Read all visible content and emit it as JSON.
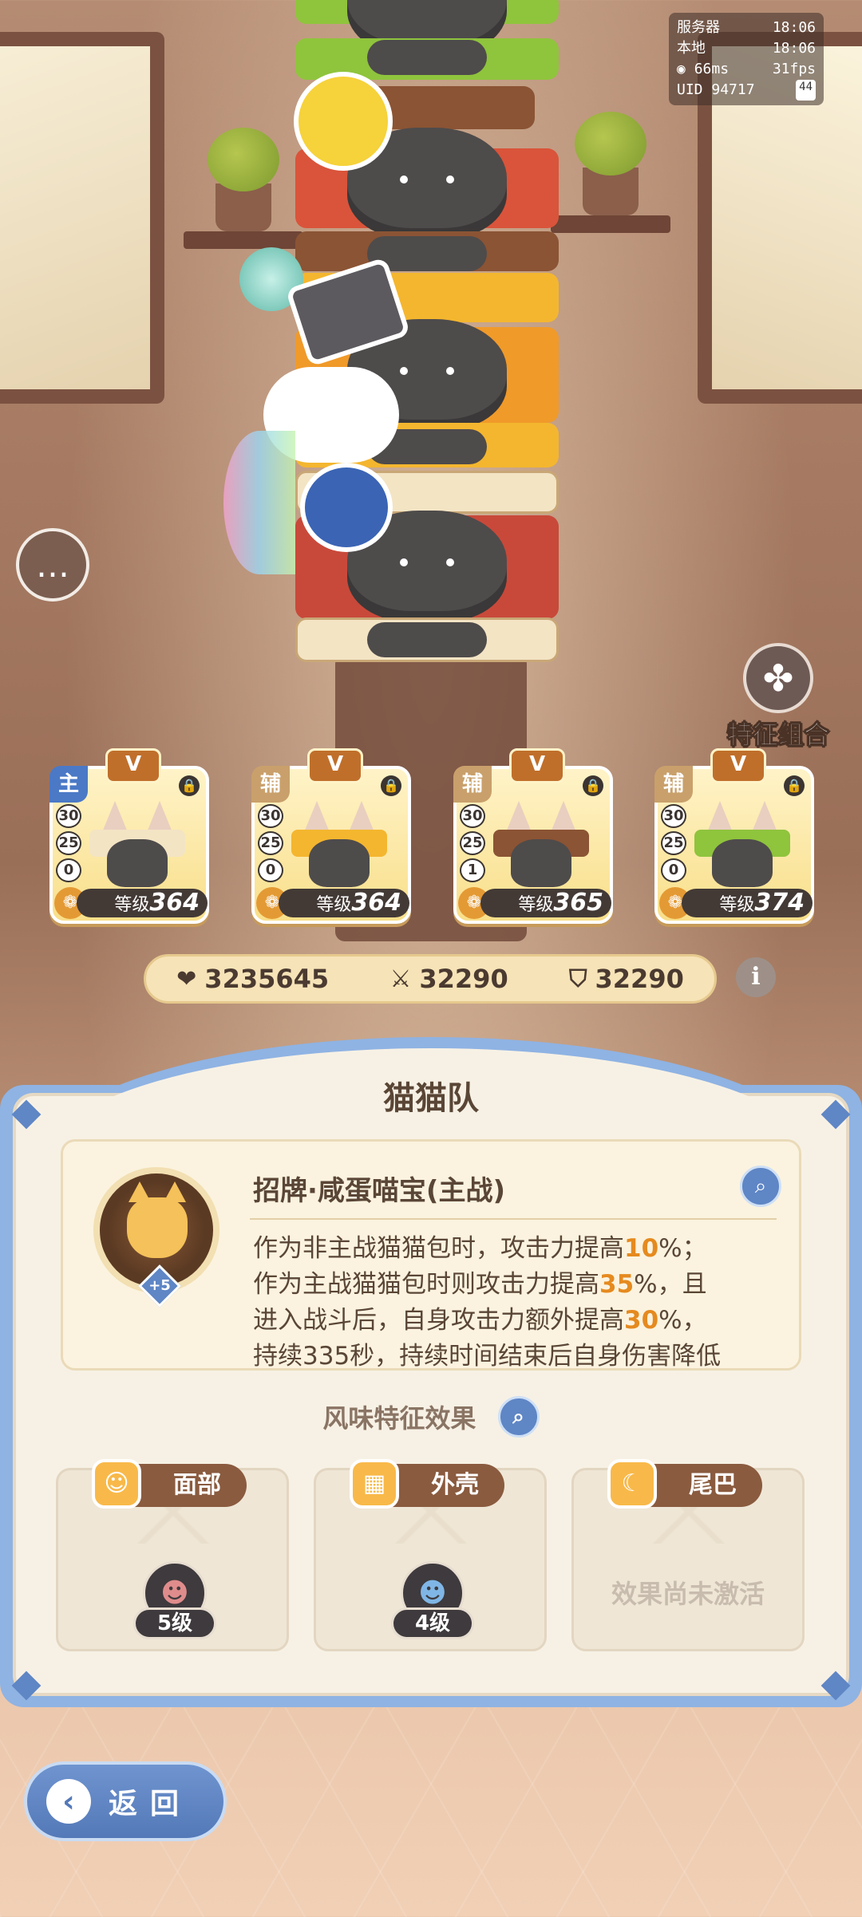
{
  "status": {
    "server_label": "服务器",
    "server_time": "18:06",
    "local_label": "本地",
    "local_time": "18:06",
    "ping": "66ms",
    "fps": "31fps",
    "uid_label": "UID",
    "uid": "94717",
    "battery": "44"
  },
  "trait_combo": {
    "label": "特征组合",
    "icon": "flower-icon"
  },
  "chat": {
    "icon": "chat-bubble-icon"
  },
  "team": [
    {
      "badge": "V",
      "role": "主",
      "stats": [
        "30",
        "25",
        "0"
      ],
      "level_label": "等级",
      "level": "364",
      "bread_color": "#f3e4c4"
    },
    {
      "badge": "V",
      "role": "辅",
      "stats": [
        "30",
        "25",
        "0"
      ],
      "level_label": "等级",
      "level": "364",
      "bread_color": "#f4b62f"
    },
    {
      "badge": "V",
      "role": "辅",
      "stats": [
        "30",
        "25",
        "1"
      ],
      "level_label": "等级",
      "level": "365",
      "bread_color": "#8b5434"
    },
    {
      "badge": "V",
      "role": "辅",
      "stats": [
        "30",
        "25",
        "0"
      ],
      "level_label": "等级",
      "level": "374",
      "bread_color": "#8fc43d"
    }
  ],
  "totals": {
    "hp": "3235645",
    "hp_icon": "heart-icon",
    "attack": "32290",
    "attack_icon": "crossed-swords-icon",
    "defense": "32290",
    "defense_icon": "shield-icon"
  },
  "panel": {
    "title": "猫猫队",
    "skill": {
      "name": "招牌·咸蛋喵宝(主战)",
      "bonus": "+5",
      "desc": [
        {
          "text": "作为非主战猫猫包时，攻击力提高",
          "hl": "10",
          "after": "%；"
        },
        {
          "text": "作为主战猫猫包时则攻击力提高",
          "hl": "35",
          "after": "%，且"
        },
        {
          "text": "进入战斗后，自身攻击力额外提高",
          "hl": "30",
          "after": "%，"
        },
        {
          "text": "持续335秒，持续时间结束后自身伤害降低",
          "hl": "",
          "after": ""
        }
      ]
    },
    "flavor_title": "风味特征效果",
    "traits": [
      {
        "name": "面部",
        "icon": "cat-face-icon",
        "level": "5级",
        "gem_icon": "pink-cat-gem-icon"
      },
      {
        "name": "外壳",
        "icon": "shell-icon",
        "level": "4级",
        "gem_icon": "blue-cat-gem-icon"
      },
      {
        "name": "尾巴",
        "icon": "tail-icon",
        "inactive": "效果尚未激活"
      }
    ]
  },
  "back": {
    "label": "返回"
  }
}
